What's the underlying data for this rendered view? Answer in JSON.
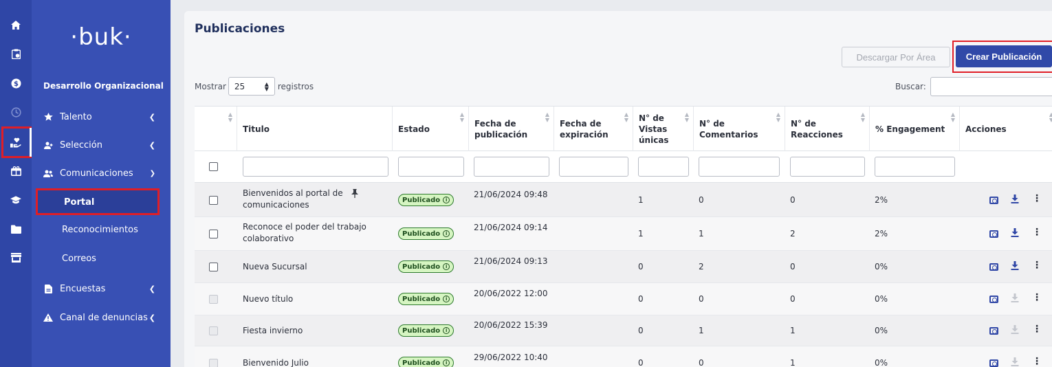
{
  "rail": {
    "icons": [
      "home-icon",
      "clipboard-clock-icon",
      "dollar-icon",
      "clock-icon",
      "hand-heart-icon",
      "gift-icon",
      "graduation-cap-icon",
      "folder-icon",
      "store-icon"
    ]
  },
  "sidebar": {
    "logo": "·buk·",
    "section_title": "Desarrollo Organizacional",
    "items": [
      {
        "label": "Talento",
        "icon": "star-icon"
      },
      {
        "label": "Selección",
        "icon": "user-plus-icon"
      },
      {
        "label": "Comunicaciones",
        "icon": "people-icon"
      },
      {
        "label": "Encuestas",
        "icon": "document-icon"
      },
      {
        "label": "Canal de denuncias",
        "icon": "warning-icon"
      }
    ],
    "subitems": [
      {
        "label": "Portal"
      },
      {
        "label": "Reconocimientos"
      },
      {
        "label": "Correos"
      }
    ]
  },
  "main": {
    "title": "Publicaciones",
    "btn_download": "Descargar Por Área",
    "btn_create": "Crear Publicación",
    "show_label": "Mostrar",
    "show_value": "25",
    "records_label": "registros",
    "search_label": "Buscar:"
  },
  "table": {
    "headers": {
      "titulo": "Titulo",
      "estado": "Estado",
      "fecha_pub": "Fecha de publicación",
      "fecha_exp": "Fecha de expiración",
      "vistas": "N° de Vistas únicas",
      "comentarios": "N° de Comentarios",
      "reacciones": "N° de Reacciones",
      "engagement": "% Engagement",
      "acciones": "Acciones"
    },
    "rows": [
      {
        "titulo": "Bienvenidos al portal de comunicaciones",
        "estado": "Publicado",
        "fecha_pub": "21/06/2024 09:48",
        "fecha_exp": "",
        "vistas": "1",
        "comentarios": "0",
        "reacciones": "0",
        "engagement": "2%"
      },
      {
        "titulo": "Reconoce el poder del trabajo colaborativo",
        "estado": "Publicado",
        "fecha_pub": "21/06/2024 09:14",
        "fecha_exp": "",
        "vistas": "1",
        "comentarios": "1",
        "reacciones": "2",
        "engagement": "2%"
      },
      {
        "titulo": "Nueva Sucursal",
        "estado": "Publicado",
        "fecha_pub": "21/06/2024 09:13",
        "fecha_exp": "",
        "vistas": "0",
        "comentarios": "2",
        "reacciones": "0",
        "engagement": "0%"
      },
      {
        "titulo": "Nuevo título",
        "estado": "Publicado",
        "fecha_pub": "20/06/2022 12:00",
        "fecha_exp": "",
        "vistas": "0",
        "comentarios": "0",
        "reacciones": "0",
        "engagement": "0%"
      },
      {
        "titulo": "Fiesta invierno",
        "estado": "Publicado",
        "fecha_pub": "20/06/2022 15:39",
        "fecha_exp": "",
        "vistas": "0",
        "comentarios": "1",
        "reacciones": "1",
        "engagement": "0%"
      },
      {
        "titulo": "Bienvenido Julio",
        "estado": "Publicado",
        "fecha_pub": "29/06/2022 10:40",
        "fecha_exp": "",
        "vistas": "0",
        "comentarios": "0",
        "reacciones": "1",
        "engagement": "0%"
      }
    ]
  },
  "colors": {
    "rail": "#2f46a6",
    "sidebar": "#3850b4",
    "primary_button": "#3049a8",
    "highlight": "#e01e26",
    "badge_bg": "#d6f5c2"
  }
}
